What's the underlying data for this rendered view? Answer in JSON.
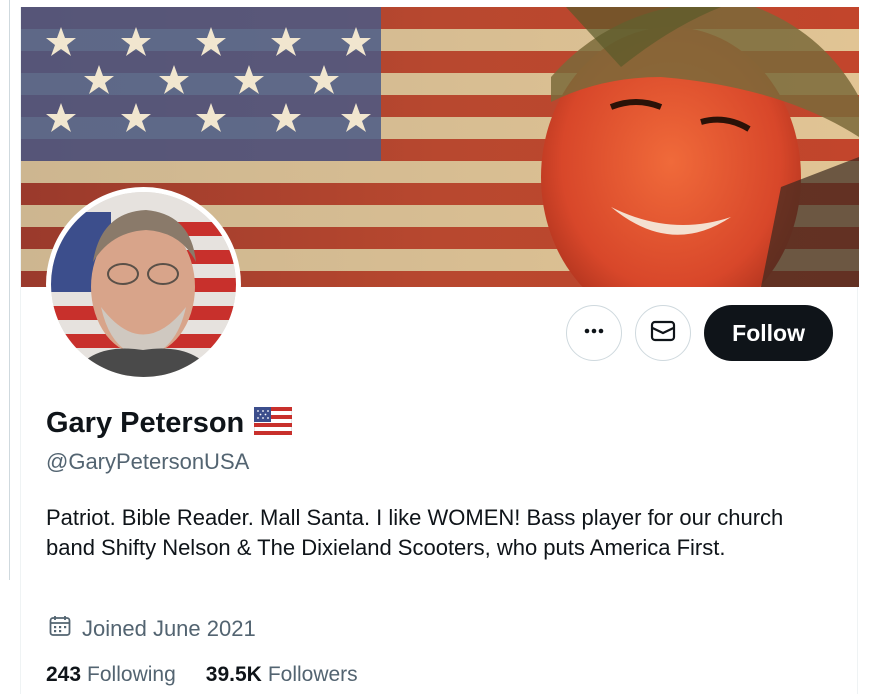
{
  "profile": {
    "display_name": "Gary Peterson",
    "handle": "@GaryPetersonUSA",
    "bio": "Patriot. Bible Reader. Mall Santa. I like WOMEN! Bass player for our church band Shifty Nelson & The Dixieland Scooters, who puts America First.",
    "joined": "Joined June 2021",
    "following_count": "243",
    "following_label": "Following",
    "followers_count": "39.5K",
    "followers_label": "Followers"
  },
  "actions": {
    "more_icon": "more-horizontal-icon",
    "message_icon": "envelope-icon",
    "follow_label": "Follow"
  },
  "icons": {
    "name_badge": "us-flag-icon",
    "joined": "calendar-icon"
  },
  "colors": {
    "text_primary": "#0f1419",
    "text_secondary": "#536471",
    "button_dark": "#0f1419",
    "border": "#cfd9de"
  }
}
